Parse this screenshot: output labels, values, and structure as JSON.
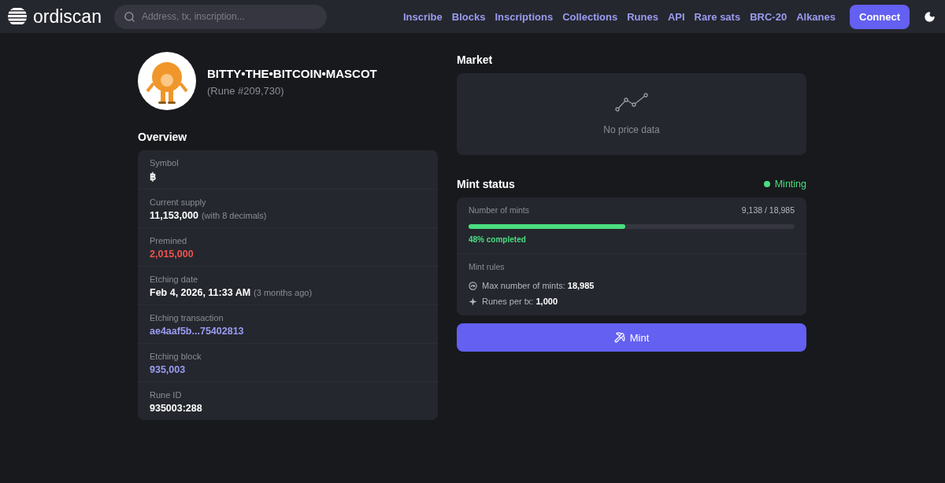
{
  "header": {
    "brand": "ordiscan",
    "search": {
      "placeholder": "Address, tx, inscription..."
    },
    "nav": [
      "Inscribe",
      "Blocks",
      "Inscriptions",
      "Collections",
      "Runes",
      "API",
      "Rare sats",
      "BRC-20",
      "Alkanes"
    ],
    "connect": "Connect"
  },
  "rune": {
    "name": "BITTY•THE•BITCOIN•MASCOT",
    "number": "(Rune #209,730)"
  },
  "overview": {
    "title": "Overview",
    "fields": [
      {
        "label": "Symbol",
        "value": "฿",
        "kind": "text"
      },
      {
        "label": "Current supply",
        "value": "11,153,000",
        "note": "(with 8 decimals)",
        "kind": "text"
      },
      {
        "label": "Premined",
        "value": "2,015,000",
        "kind": "alert"
      },
      {
        "label": "Etching date",
        "value": "Feb 4, 2026, 11:33 AM",
        "note": "(3 months ago)",
        "kind": "text"
      },
      {
        "label": "Etching transaction",
        "value": "ae4aaf5b...75402813",
        "kind": "link"
      },
      {
        "label": "Etching block",
        "value": "935,003",
        "kind": "link"
      },
      {
        "label": "Rune ID",
        "value": "935003:288",
        "kind": "text"
      }
    ]
  },
  "market": {
    "title": "Market",
    "empty": "No price data"
  },
  "mint_status": {
    "title": "Mint status",
    "status": {
      "label": "Minting",
      "color": "#4ade80"
    },
    "mints_label": "Number of mints",
    "mints_count": "9,138 / 18,985",
    "level": 0.48,
    "progress_text": "48% completed",
    "rules_title": "Mint rules",
    "rules": [
      {
        "kind": "gauge",
        "label": "Max number of mints:",
        "value": "18,985"
      },
      {
        "kind": "sparkle",
        "label": "Runes per tx:",
        "value": "1,000"
      }
    ],
    "button": "Mint"
  }
}
